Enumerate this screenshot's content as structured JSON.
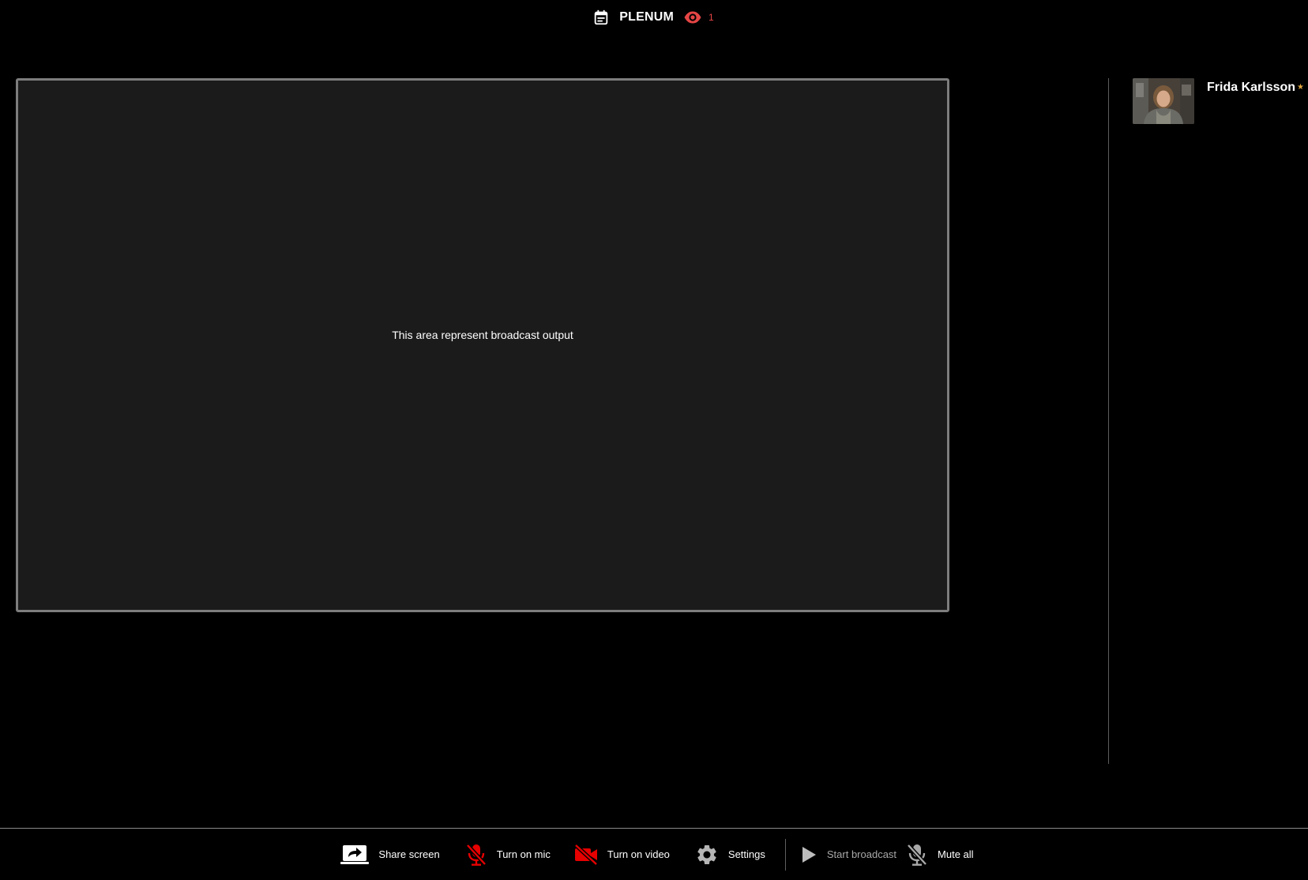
{
  "header": {
    "room_title": "PLENUM",
    "viewer_count": "1",
    "calendar_icon": "calendar-icon",
    "viewers_icon": "eye-icon"
  },
  "stage": {
    "placeholder_text": "This area represent broadcast output"
  },
  "participants": [
    {
      "name": "Frida Karlsson",
      "role_marker": "★",
      "avatar": "participant-video-thumbnail"
    }
  ],
  "toolbar": {
    "share_screen": "Share screen",
    "turn_on_mic": "Turn on mic",
    "turn_on_video": "Turn on video",
    "settings": "Settings",
    "start_broadcast": "Start broadcast",
    "mute_all": "Mute all"
  },
  "colors": {
    "background": "#000000",
    "stage_background": "#1b1b1b",
    "stage_border": "#7d7d7d",
    "accent_red": "#e64545",
    "muted_red": "#e60000",
    "host_star": "#e0a640"
  }
}
